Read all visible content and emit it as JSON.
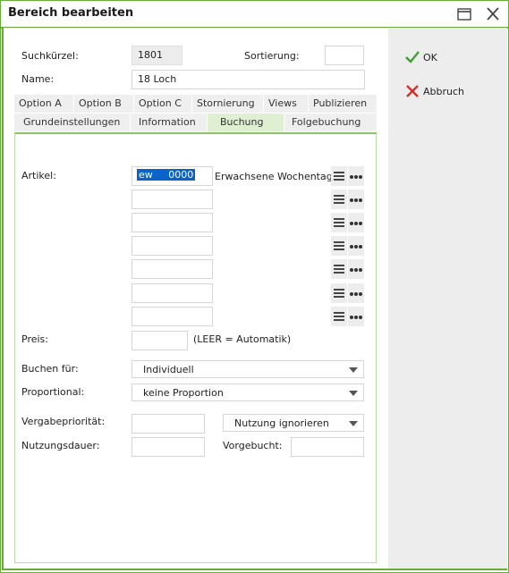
{
  "window": {
    "title": "Bereich bearbeiten"
  },
  "header": {
    "suchkuerzel_label": "Suchkürzel:",
    "suchkuerzel_value": "1801",
    "sortierung_label": "Sortierung:",
    "sortierung_value": "",
    "name_label": "Name:",
    "name_value": "18 Loch"
  },
  "tabs_row1": [
    "Option A",
    "Option B",
    "Option C",
    "Stornierung",
    "Views",
    "Publizieren"
  ],
  "tabs_row2": [
    "Grundeinstellungen",
    "Information",
    "Buchung",
    "Folgebuchung"
  ],
  "active_tab": "Buchung",
  "form": {
    "artikel_label": "Artikel:",
    "artikel_rows": [
      {
        "value_code": "ew",
        "value_num": "0000",
        "description": "Erwachsene Wochentags"
      },
      {
        "value_code": "",
        "value_num": "",
        "description": ""
      },
      {
        "value_code": "",
        "value_num": "",
        "description": ""
      },
      {
        "value_code": "",
        "value_num": "",
        "description": ""
      },
      {
        "value_code": "",
        "value_num": "",
        "description": ""
      },
      {
        "value_code": "",
        "value_num": "",
        "description": ""
      },
      {
        "value_code": "",
        "value_num": "",
        "description": ""
      }
    ],
    "preis_label": "Preis:",
    "preis_value": "",
    "preis_hint": "(LEER = Automatik)",
    "buchen_fuer_label": "Buchen für:",
    "buchen_fuer_value": "Individuell",
    "proportional_label": "Proportional:",
    "proportional_value": "keine Proportion",
    "vergabe_label": "Vergabepriorität:",
    "vergabe_value": "",
    "nutzung_select": "Nutzung ignorieren",
    "nutzungsdauer_label": "Nutzungsdauer:",
    "nutzungsdauer_value": "",
    "vorgebucht_label": "Vorgebucht:",
    "vorgebucht_value": ""
  },
  "actions": {
    "ok": "OK",
    "abbruch": "Abbruch"
  },
  "colors": {
    "accent": "#6aac3a",
    "ok_check": "#3f9e2f",
    "cancel_x": "#d0302a",
    "selection": "#0a63c9"
  }
}
